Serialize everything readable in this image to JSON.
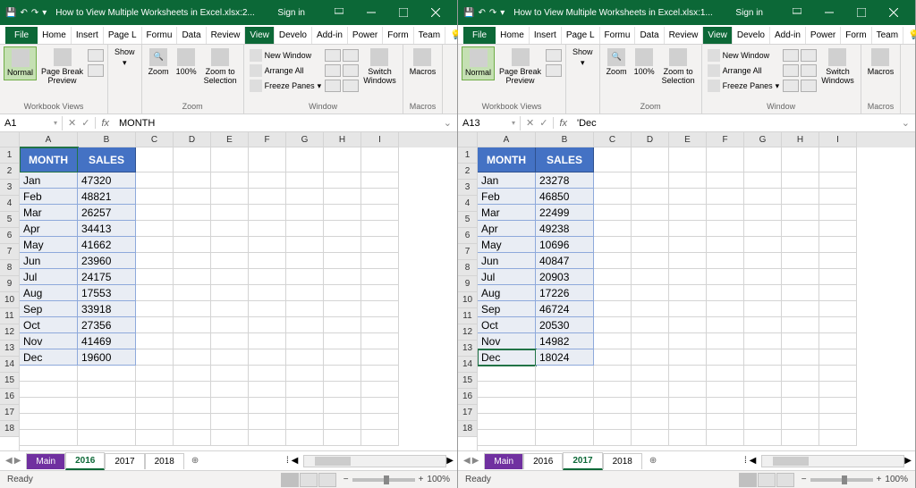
{
  "app": {
    "title_left": "How to View Multiple Worksheets in Excel.xlsx:2...",
    "title_right": "How to View Multiple Worksheets in Excel.xlsx:1...",
    "signin": "Sign in",
    "ready": "Ready",
    "zoom_pct": "100%"
  },
  "tabs": {
    "file": "File",
    "home": "Home",
    "insert": "Insert",
    "pagel": "Page L",
    "formu": "Formu",
    "data": "Data",
    "review": "Review",
    "view": "View",
    "develo": "Develo",
    "addin": "Add-in",
    "power": "Power",
    "form": "Form",
    "team": "Team",
    "tellme": "Tell me"
  },
  "ribbon": {
    "normal": "Normal",
    "page_break": "Page Break\nPreview",
    "show": "Show",
    "zoom": "Zoom",
    "pct100": "100%",
    "zoom_sel": "Zoom to\nSelection",
    "new_window": "New Window",
    "arrange_all": "Arrange All",
    "freeze_panes": "Freeze Panes",
    "switch_windows": "Switch\nWindows",
    "macros": "Macros",
    "grp_workbook": "Workbook Views",
    "grp_zoom": "Zoom",
    "grp_window": "Window",
    "grp_macros": "Macros"
  },
  "left": {
    "namebox": "A1",
    "formula": "MONTH",
    "headers": {
      "a": "MONTH",
      "b": "SALES"
    },
    "rows": [
      {
        "m": "Jan",
        "s": "47320"
      },
      {
        "m": "Feb",
        "s": "48821"
      },
      {
        "m": "Mar",
        "s": "26257"
      },
      {
        "m": "Apr",
        "s": "34413"
      },
      {
        "m": "May",
        "s": "41662"
      },
      {
        "m": "Jun",
        "s": "23960"
      },
      {
        "m": "Jul",
        "s": "24175"
      },
      {
        "m": "Aug",
        "s": "17553"
      },
      {
        "m": "Sep",
        "s": "33918"
      },
      {
        "m": "Oct",
        "s": "27356"
      },
      {
        "m": "Nov",
        "s": "41469"
      },
      {
        "m": "Dec",
        "s": "19600"
      }
    ],
    "sheets": {
      "main": "Main",
      "s2016": "2016",
      "s2017": "2017",
      "s2018": "2018"
    }
  },
  "right": {
    "namebox": "A13",
    "formula": "'Dec",
    "headers": {
      "a": "MONTH",
      "b": "SALES"
    },
    "rows": [
      {
        "m": "Jan",
        "s": "23278"
      },
      {
        "m": "Feb",
        "s": "46850"
      },
      {
        "m": "Mar",
        "s": "22499"
      },
      {
        "m": "Apr",
        "s": "49238"
      },
      {
        "m": "May",
        "s": "10696"
      },
      {
        "m": "Jun",
        "s": "40847"
      },
      {
        "m": "Jul",
        "s": "20903"
      },
      {
        "m": "Aug",
        "s": "17226"
      },
      {
        "m": "Sep",
        "s": "46724"
      },
      {
        "m": "Oct",
        "s": "20530"
      },
      {
        "m": "Nov",
        "s": "14982"
      },
      {
        "m": "Dec",
        "s": "18024"
      }
    ],
    "sheets": {
      "main": "Main",
      "s2016": "2016",
      "s2017": "2017",
      "s2018": "2018"
    }
  }
}
